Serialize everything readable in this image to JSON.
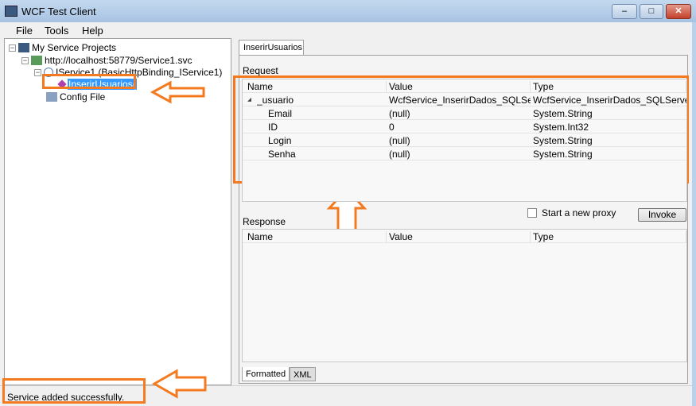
{
  "window": {
    "title": "WCF Test Client",
    "minimize": "–",
    "maximize": "□",
    "close": "✕"
  },
  "menu": [
    "File",
    "Tools",
    "Help"
  ],
  "tree": {
    "root": "My Service Projects",
    "service": "http://localhost:58779/Service1.svc",
    "contract": "IService1 (BasicHttpBinding_IService1)",
    "operation": "InserirUsuarios(",
    "config": "Config File"
  },
  "tab": "InserirUsuarios",
  "request": {
    "label": "Request",
    "columns": [
      "Name",
      "Value",
      "Type"
    ],
    "rows": [
      [
        "_usuario",
        "WcfService_InserirDados_SQLServer",
        "WcfService_InserirDados_SQLServer"
      ],
      [
        "Email",
        "(null)",
        "System.String"
      ],
      [
        "ID",
        "0",
        "System.Int32"
      ],
      [
        "Login",
        "(null)",
        "System.String"
      ],
      [
        "Senha",
        "(null)",
        "System.String"
      ]
    ]
  },
  "response": {
    "label": "Response",
    "columns": [
      "Name",
      "Value",
      "Type"
    ]
  },
  "new_proxy": {
    "label": "Start a new proxy",
    "checked": false
  },
  "invoke": "Invoke",
  "bottom_tabs": [
    "Formatted",
    "XML"
  ],
  "status": "Service added successfully.",
  "colors": {
    "annotation": "#f47a20",
    "selection": "#3399ff"
  }
}
